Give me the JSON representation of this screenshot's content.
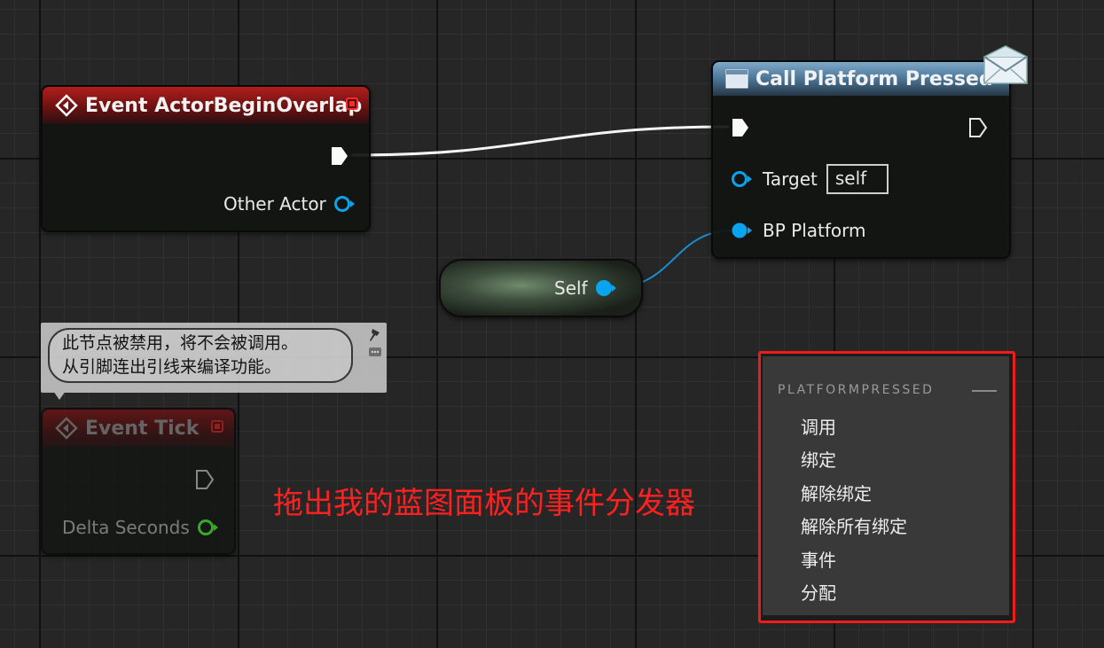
{
  "event_overlap_node": {
    "title": "Event ActorBeginOverlap",
    "pin_other_actor": "Other Actor"
  },
  "call_platform_node": {
    "title": "Call Platform Pressed",
    "pin_target": "Target",
    "target_value": "self",
    "pin_bp_platform": "BP Platform"
  },
  "self_node": {
    "label": "Self"
  },
  "comment": {
    "line1": "此节点被禁用，将不会被调用。",
    "line2": "从引脚连出引线来编译功能。"
  },
  "event_tick_node": {
    "title": "Event Tick",
    "pin_delta_seconds": "Delta Seconds"
  },
  "annotation": {
    "text": "拖出我的蓝图面板的事件分发器"
  },
  "context_menu": {
    "title": "PLATFORMPRESSED",
    "items": [
      "调用",
      "绑定",
      "解除绑定",
      "解除所有绑定",
      "事件",
      "分配"
    ]
  },
  "colors": {
    "event_header": "#b21e1e",
    "function_header": "#4b7597",
    "object_pin": "#0aa3f0",
    "float_pin": "#3dbf2e",
    "annotation": "#ff2020",
    "menu_border": "#ef1c1c"
  }
}
